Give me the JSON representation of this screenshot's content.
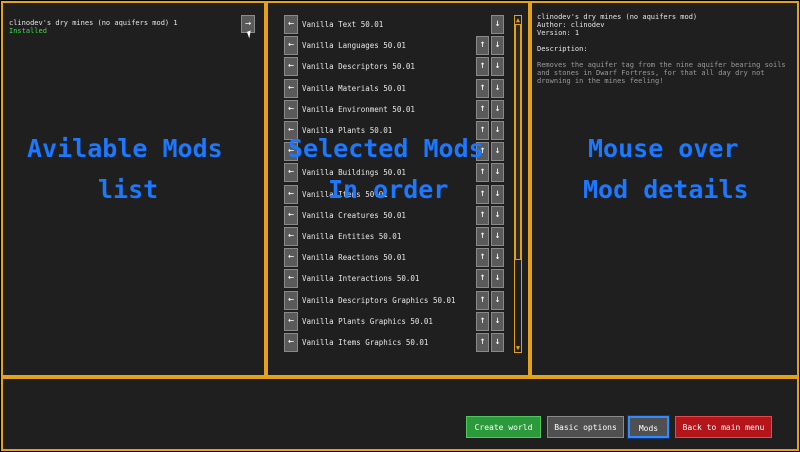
{
  "available": {
    "mod_title": "clinodev's dry mines (no aquifers mod) 1",
    "mod_status": "Installed",
    "move_icon": "right-arrow-icon",
    "overlay_line1": "Avilable Mods",
    "overlay_line2": "list"
  },
  "selected": {
    "overlay_line1": "Selected Mods",
    "overlay_line2": "In order",
    "items": [
      {
        "name": "Vanilla Text 50.01"
      },
      {
        "name": "Vanilla Languages 50.01"
      },
      {
        "name": "Vanilla Descriptors 50.01"
      },
      {
        "name": "Vanilla Materials 50.01"
      },
      {
        "name": "Vanilla Environment 50.01"
      },
      {
        "name": "Vanilla Plants 50.01"
      },
      {
        "name": ""
      },
      {
        "name": "Vanilla Buildings 50.01"
      },
      {
        "name": "Vanilla Items 50.01"
      },
      {
        "name": "Vanilla Creatures 50.01"
      },
      {
        "name": "Vanilla Entities 50.01"
      },
      {
        "name": "Vanilla Reactions 50.01"
      },
      {
        "name": "Vanilla Interactions 50.01"
      },
      {
        "name": "Vanilla Descriptors Graphics 50.01"
      },
      {
        "name": "Vanilla Plants Graphics 50.01"
      },
      {
        "name": "Vanilla Items Graphics 50.01"
      }
    ]
  },
  "details": {
    "title": "clinodev's dry mines (no aquifers mod)",
    "author": "Author: clinodev",
    "version": "Version: 1",
    "desc_label": "Description:",
    "desc_line1": "Removes the aquifer tag from the nine aquifer bearing soils",
    "desc_line2": "and stones in Dwarf Fortress, for that all day dry not",
    "desc_line3": "drowning in the mines feeling!",
    "overlay_line1": "Mouse over",
    "overlay_line2": "Mod details"
  },
  "buttons": {
    "create_world": "Create world",
    "basic_options": "Basic options",
    "mods": "Mods",
    "back": "Back to main menu"
  },
  "glyphs": {
    "left": "←",
    "right": "→",
    "up": "↑",
    "down": "↓",
    "scroll_up": "▲",
    "scroll_down": "▼"
  },
  "colors": {
    "border": "#e3a21a",
    "overlay": "#1b78ff",
    "installed": "#3fdc4a",
    "create": "#2b9a3a",
    "back": "#b3151a"
  }
}
